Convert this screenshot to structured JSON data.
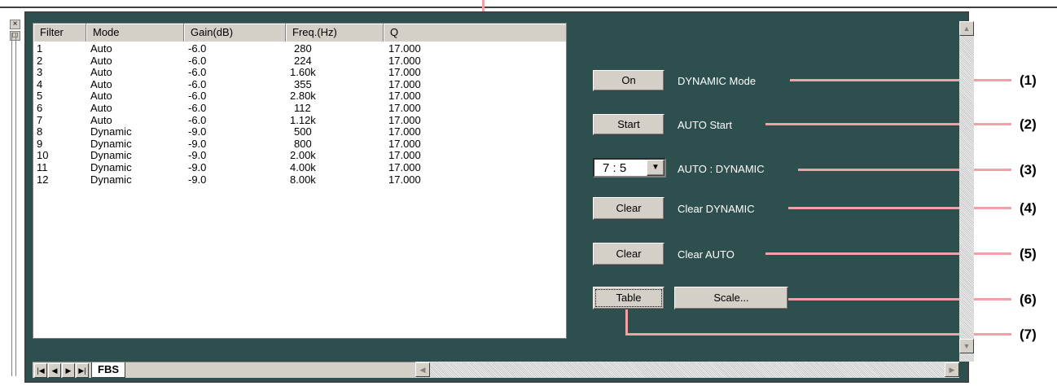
{
  "table": {
    "headers": [
      "Filter",
      "Mode",
      "Gain(dB)",
      "Freq.(Hz)",
      "Q"
    ],
    "rows": [
      [
        "1",
        "Auto",
        "-6.0",
        "280",
        "17.000"
      ],
      [
        "2",
        "Auto",
        "-6.0",
        "224",
        "17.000"
      ],
      [
        "3",
        "Auto",
        "-6.0",
        "1.60k",
        "17.000"
      ],
      [
        "4",
        "Auto",
        "-6.0",
        "355",
        "17.000"
      ],
      [
        "5",
        "Auto",
        "-6.0",
        "2.80k",
        "17.000"
      ],
      [
        "6",
        "Auto",
        "-6.0",
        "112",
        "17.000"
      ],
      [
        "7",
        "Auto",
        "-6.0",
        "1.12k",
        "17.000"
      ],
      [
        "8",
        "Dynamic",
        "-9.0",
        "500",
        "17.000"
      ],
      [
        "9",
        "Dynamic",
        "-9.0",
        "800",
        "17.000"
      ],
      [
        "10",
        "Dynamic",
        "-9.0",
        "2.00k",
        "17.000"
      ],
      [
        "11",
        "Dynamic",
        "-9.0",
        "4.00k",
        "17.000"
      ],
      [
        "12",
        "Dynamic",
        "-9.0",
        "8.00k",
        "17.000"
      ]
    ]
  },
  "controls": {
    "dynamic_mode": {
      "button": "On",
      "label": "DYNAMIC Mode",
      "callout": "(1)"
    },
    "auto_start": {
      "button": "Start",
      "label": "AUTO Start",
      "callout": "(2)"
    },
    "ratio": {
      "value": "7 : 5",
      "label": "AUTO : DYNAMIC",
      "callout": "(3)"
    },
    "clear_dynamic": {
      "button": "Clear",
      "label": "Clear DYNAMIC",
      "callout": "(4)"
    },
    "clear_auto": {
      "button": "Clear",
      "label": "Clear AUTO",
      "callout": "(5)"
    },
    "scale": {
      "button": "Scale...",
      "callout": "(6)"
    },
    "table": {
      "button": "Table",
      "callout": "(7)"
    }
  },
  "tabs": {
    "active": "FBS"
  },
  "mini_toolbar": {
    "close": "×",
    "restore": "□"
  },
  "colors": {
    "panel_bg": "#2d4f4d",
    "callout_line": "#f2a0a8",
    "button_face": "#d4d0c8"
  }
}
